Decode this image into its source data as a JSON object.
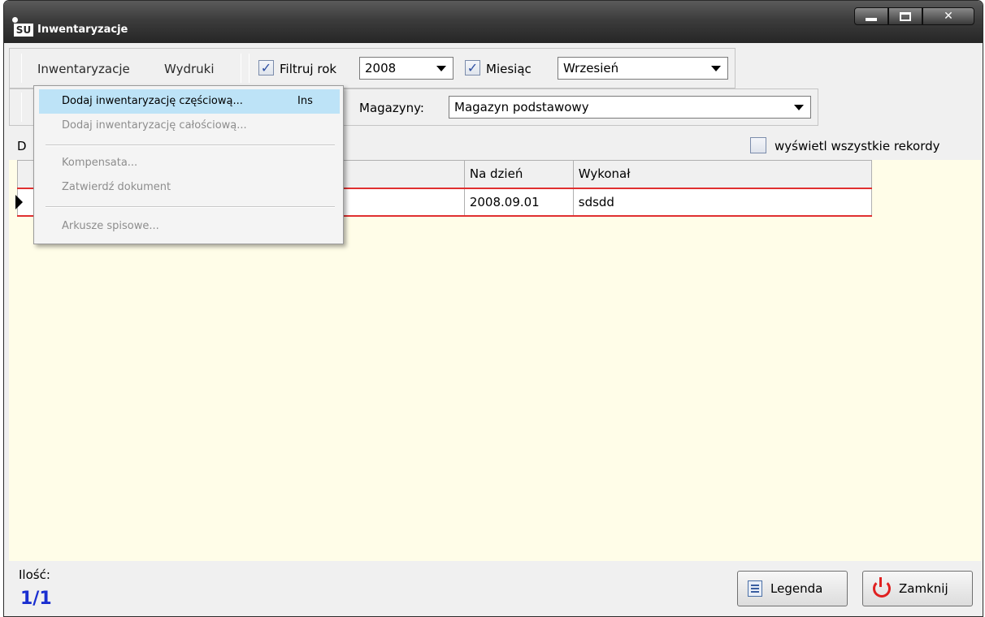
{
  "window": {
    "title": "Inwentaryzacje",
    "logo_text": "SU"
  },
  "toolbar": {
    "menu_inwentaryzacje": "Inwentaryzacje",
    "menu_wydruki": "Wydruki",
    "filter_year_label": "Filtruj rok",
    "filter_year_checked": true,
    "year_value": "2008",
    "month_label": "Miesiąc",
    "month_checked": true,
    "month_value": "Wrzesień",
    "warehouse_label": "Magazyny:",
    "warehouse_value": "Magazyn podstawowy",
    "show_all_label": "wyświetl wszystkie rekordy",
    "show_all_checked": false
  },
  "dropdown": {
    "items": [
      {
        "label": "Dodaj inwentaryzację częściową...",
        "shortcut": "Ins",
        "state": "highlighted"
      },
      {
        "label": "Dodaj inwentaryzację całościową...",
        "shortcut": "",
        "state": "disabled"
      },
      {
        "label": "Kompensata...",
        "shortcut": "",
        "state": "disabled"
      },
      {
        "label": "Zatwierdź dokument",
        "shortcut": "",
        "state": "disabled"
      },
      {
        "label": "Arkusze spisowe...",
        "shortcut": "",
        "state": "disabled"
      }
    ]
  },
  "grid": {
    "left_label": "D",
    "columns": [
      "",
      "Na dzień",
      "Wykonał"
    ],
    "rows": [
      {
        "cells": [
          "",
          "2008.09.01",
          "sdsdd"
        ]
      }
    ]
  },
  "status": {
    "count_label": "Ilość:",
    "count_value": "1/1"
  },
  "buttons": {
    "legend": "Legenda",
    "close": "Zamknij"
  },
  "colors": {
    "row_border": "#e03030",
    "grid_bg": "#fffde8",
    "highlight": "#bde3f7",
    "count": "#1a2fd0"
  }
}
